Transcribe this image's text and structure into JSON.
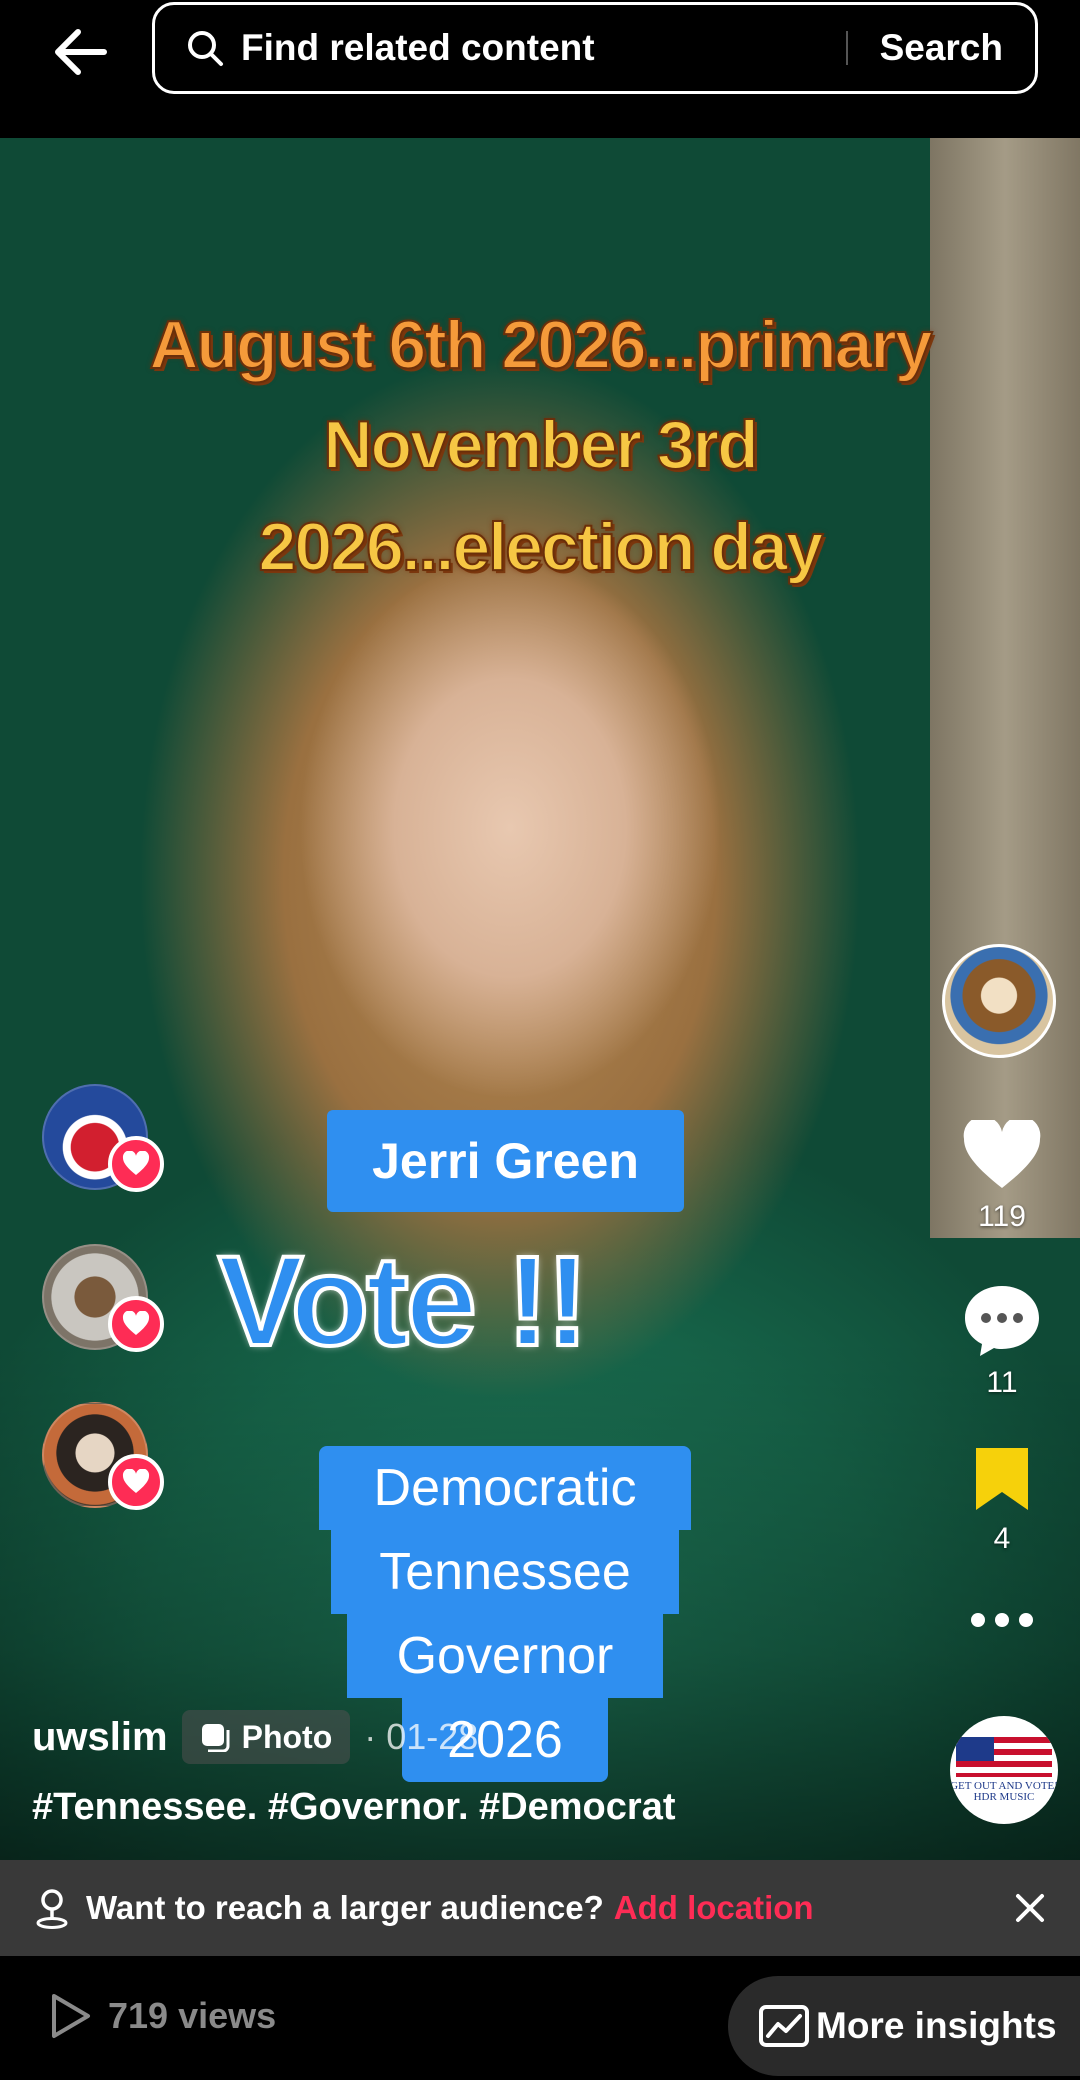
{
  "search": {
    "placeholder": "Find related content",
    "button_label": "Search"
  },
  "overlay": {
    "headline_line1": "August 6th 2026...primary",
    "headline_line2": "November 3rd",
    "headline_line3": "2026...election day",
    "name": "Jerri Green",
    "vote": "Vote !!",
    "tag_lines": [
      "Democratic",
      "Tennessee",
      "Governor",
      "2026"
    ]
  },
  "actions": {
    "likes": "119",
    "comments": "11",
    "favorites": "4"
  },
  "music": {
    "label": "GET OUT AND VOTE! HDR MUSIC"
  },
  "post": {
    "username": "uwslim",
    "type_label": "Photo",
    "date": "· 01-28",
    "hashtags": "#Tennessee. #Governor. #Democrat"
  },
  "location_prompt": {
    "text": "Want to reach a larger audience?",
    "link": "Add location"
  },
  "stats": {
    "views": "719 views",
    "insights_label": "More insights"
  },
  "colors": {
    "accent_red": "#fe2c55",
    "overlay_blue": "#2f8ff0",
    "headline_gold": "#f6c744",
    "favorite_yellow": "#f6d10b"
  }
}
